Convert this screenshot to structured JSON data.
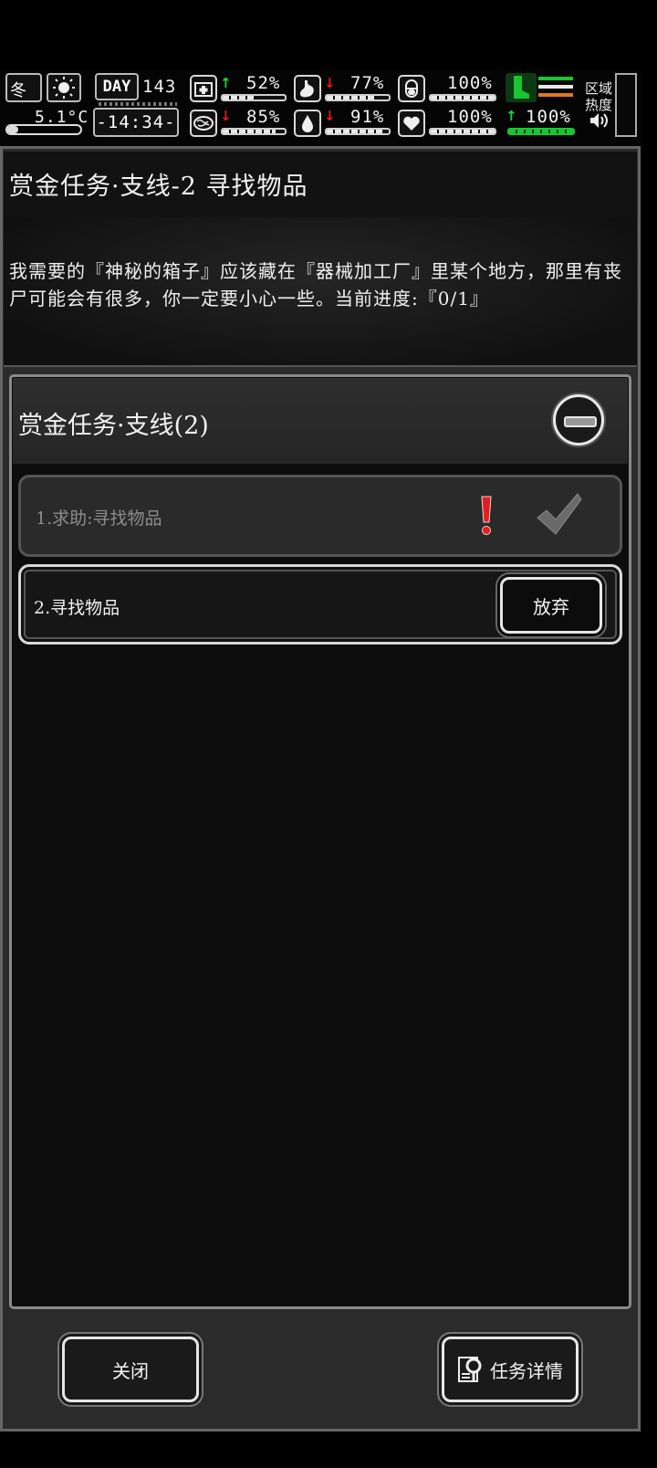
{
  "hud": {
    "season": "冬",
    "temperature": "5.1°C",
    "day_label": "DAY",
    "day": "143",
    "time": "-14:34-",
    "stats": [
      {
        "name": "health",
        "value": "52%",
        "trend": "up",
        "fill": 0.52
      },
      {
        "name": "hunger",
        "value": "77%",
        "trend": "down",
        "fill": 0.77
      },
      {
        "name": "medicine",
        "value": "100%",
        "trend": "none",
        "fill": 1.0
      },
      {
        "name": "brain",
        "value": "85%",
        "trend": "down",
        "fill": 0.85
      },
      {
        "name": "thirst",
        "value": "91%",
        "trend": "down",
        "fill": 0.91
      },
      {
        "name": "mood",
        "value": "100%",
        "trend": "none",
        "fill": 1.0
      },
      {
        "name": "stamina",
        "value": "100%",
        "trend": "up",
        "fill": 1.0
      }
    ],
    "region_heat_label_1": "区域",
    "region_heat_label_2": "热度"
  },
  "quest": {
    "title": "赏金任务·支线-2 寻找物品",
    "description": "我需要的『神秘的箱子』应该藏在『器械加工厂』里某个地方，那里有丧尸可能会有很多，你一定要小心一些。当前进度:『0/1』"
  },
  "list": {
    "category": "赏金任务·支线(2)",
    "items": [
      {
        "label": "1.求助:寻找物品",
        "status": "completed"
      },
      {
        "label": "2.寻找物品",
        "action": "放弃"
      }
    ]
  },
  "buttons": {
    "close": "关闭",
    "details": "任务详情"
  },
  "colors": {
    "accent_green": "#19c531",
    "alert_red": "#d01818",
    "frame": "#8a8a8a"
  }
}
